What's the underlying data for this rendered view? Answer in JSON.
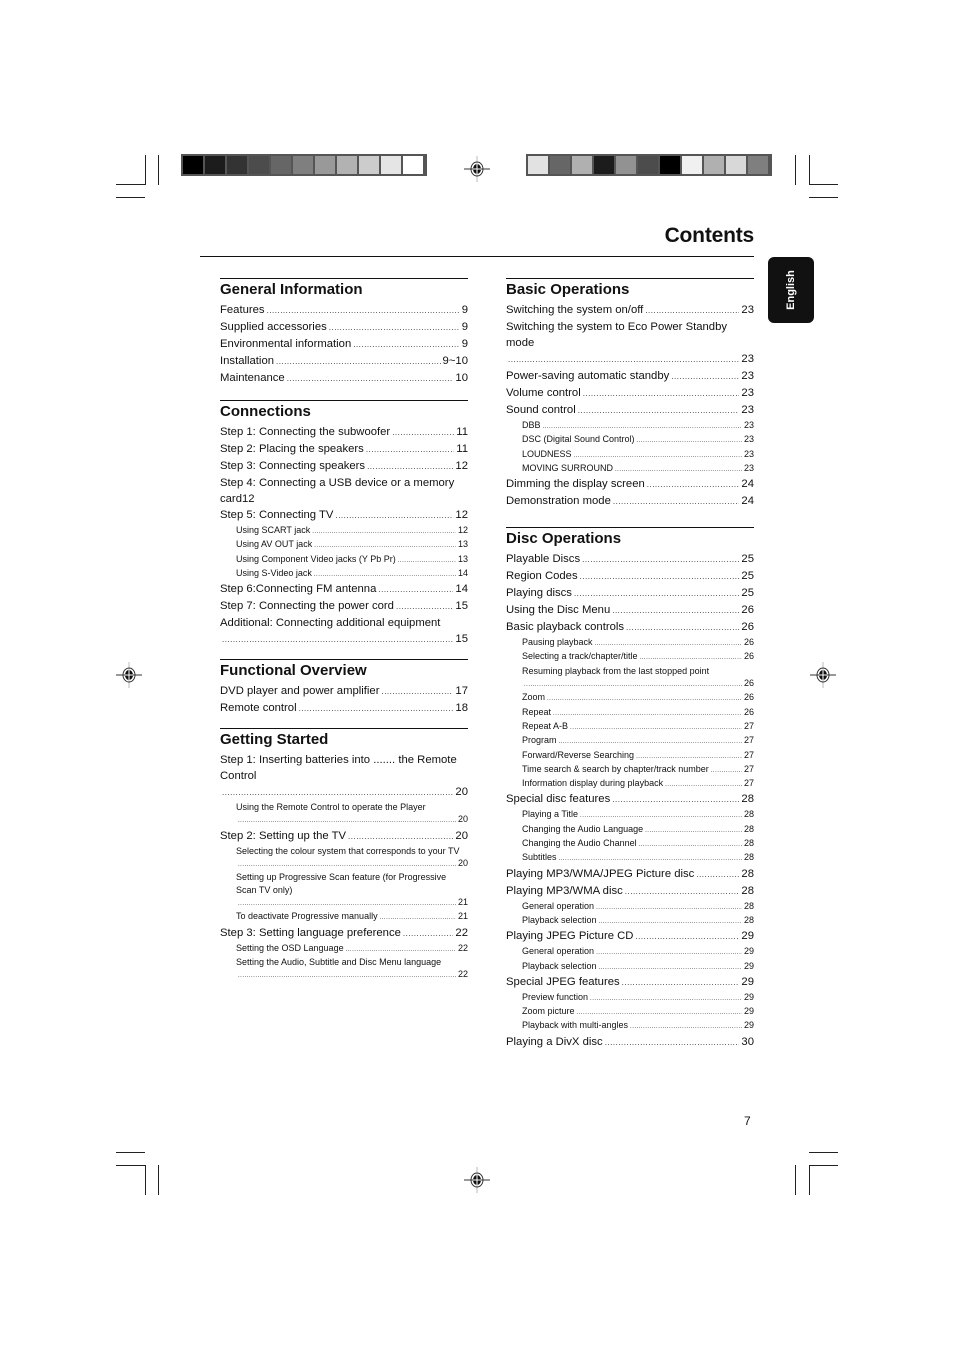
{
  "header": {
    "title": "Contents",
    "language_tab": "English",
    "left_swatches": [
      "#000000",
      "#1c1c1c",
      "#333333",
      "#4c4c4c",
      "#666666",
      "#7f7f7f",
      "#999999",
      "#b2b2b2",
      "#cccccc",
      "#e5e5e5",
      "#ffffff"
    ],
    "right_swatches": [
      "#e2e2e2",
      "#666666",
      "#b0b0b0",
      "#1c1c1c",
      "#929292",
      "#4c4c4c",
      "#000000",
      "#f0f0f0",
      "#b0b0b0",
      "#d8d8d8",
      "#7f7f7f"
    ]
  },
  "left_column": {
    "general_information": {
      "heading": "General Information",
      "entries": [
        {
          "label": "Features",
          "page": "9"
        },
        {
          "label": "Supplied accessories",
          "page": "9"
        },
        {
          "label": "Environmental information",
          "page": "9"
        },
        {
          "label": "Installation",
          "page": "9~10"
        },
        {
          "label": "Maintenance",
          "page": "10"
        }
      ]
    },
    "connections": {
      "heading": "Connections",
      "entries": [
        {
          "label": "Step 1: Connecting the subwoofer",
          "page": "11"
        },
        {
          "label": "Step 2: Placing the speakers",
          "page": "11"
        },
        {
          "label": "Step 3: Connecting speakers",
          "page": "12"
        },
        {
          "label": "Step 4: Connecting a USB device or a memory card12",
          "page": ""
        },
        {
          "label": "Step 5: Connecting TV",
          "page": "12"
        },
        {
          "label": "Using SCART jack",
          "page": "12",
          "sub": true
        },
        {
          "label": "Using AV OUT jack",
          "page": "13",
          "sub": true
        },
        {
          "label": "Using Component Video jacks (Y Pb Pr)",
          "page": "13",
          "sub": true
        },
        {
          "label": "Using S-Video jack",
          "page": "14",
          "sub": true
        },
        {
          "label": "Step 6:Connecting FM  antenna",
          "page": "14"
        },
        {
          "label": "Step 7: Connecting the power cord",
          "page": "15"
        },
        {
          "label": "Additional: Connecting additional equipment",
          "page": "15"
        }
      ]
    },
    "functional_overview": {
      "heading": "Functional Overview",
      "entries": [
        {
          "label": "DVD player and power amplifier",
          "page": "17"
        },
        {
          "label": "Remote control",
          "page": "18"
        }
      ]
    },
    "getting_started": {
      "heading": "Getting Started",
      "entries": [
        {
          "label": "Step 1: Inserting batteries into ....... the Remote Control",
          "page": "20"
        },
        {
          "label": "Using the Remote Control to operate the Player",
          "page": "20",
          "sub": true
        },
        {
          "label": "Step 2: Setting up the TV",
          "page": "20"
        },
        {
          "label": "Selecting the colour system that corresponds to your TV",
          "page": "20",
          "sub": true
        },
        {
          "label": "Setting up Progressive Scan feature (for Progressive Scan TV only)",
          "page": "21",
          "sub": true
        },
        {
          "label": "To deactivate Progressive manually",
          "page": "21",
          "sub": true
        },
        {
          "label": "Step 3: Setting language preference",
          "page": "22"
        },
        {
          "label": "Setting the OSD Language",
          "page": "22",
          "sub": true
        },
        {
          "label": "Setting the Audio, Subtitle and Disc Menu language",
          "page": "22",
          "sub": true
        }
      ]
    }
  },
  "right_column": {
    "basic_operations": {
      "heading": "Basic Operations",
      "entries": [
        {
          "label": "Switching the system on/off",
          "page": "23"
        },
        {
          "label": "Switching the system to Eco Power Standby mode",
          "page": "23"
        },
        {
          "label": "Power-saving automatic standby",
          "page": "23"
        },
        {
          "label": "Volume control",
          "page": "23"
        },
        {
          "label": "Sound control",
          "page": "23"
        },
        {
          "label": "DBB",
          "page": "23",
          "sub": true
        },
        {
          "label": "DSC (Digital Sound Control)",
          "page": "23",
          "sub": true
        },
        {
          "label": "LOUDNESS",
          "page": "23",
          "sub": true
        },
        {
          "label": "MOVING SURROUND",
          "page": "23",
          "sub": true
        },
        {
          "label": "Dimming the display screen",
          "page": "24"
        },
        {
          "label": "Demonstration mode",
          "page": "24"
        }
      ]
    },
    "disc_operations": {
      "heading": "Disc Operations",
      "entries": [
        {
          "label": "Playable Discs",
          "page": "25"
        },
        {
          "label": "Region Codes",
          "page": "25"
        },
        {
          "label": "Playing discs",
          "page": "25"
        },
        {
          "label": "Using the Disc Menu",
          "page": "26"
        },
        {
          "label": "Basic playback controls",
          "page": "26"
        },
        {
          "label": "Pausing playback",
          "page": "26",
          "sub": true
        },
        {
          "label": "Selecting a track/chapter/title",
          "page": "26",
          "sub": true
        },
        {
          "label": "Resuming playback from the last stopped point",
          "page": "26",
          "sub": true
        },
        {
          "label": "Zoom",
          "page": "26",
          "sub": true
        },
        {
          "label": "Repeat",
          "page": "26",
          "sub": true
        },
        {
          "label": "Repeat A-B",
          "page": "27",
          "sub": true
        },
        {
          "label": "Program",
          "page": "27",
          "sub": true
        },
        {
          "label": "Forward/Reverse Searching",
          "page": "27",
          "sub": true
        },
        {
          "label": "Time search & search by chapter/track number",
          "page": "27",
          "sub": true
        },
        {
          "label": "Information display during playback",
          "page": "27",
          "sub": true
        },
        {
          "label": "Special disc features",
          "page": "28"
        },
        {
          "label": "Playing a Title",
          "page": "28",
          "sub": true
        },
        {
          "label": "Changing the Audio Language",
          "page": "28",
          "sub": true
        },
        {
          "label": "Changing the Audio Channel",
          "page": "28",
          "sub": true
        },
        {
          "label": "Subtitles",
          "page": "28",
          "sub": true
        },
        {
          "label": "Playing MP3/WMA/JPEG Picture disc",
          "page": "28"
        },
        {
          "label": "Playing MP3/WMA disc",
          "page": "28"
        },
        {
          "label": "General operation",
          "page": "28",
          "sub": true
        },
        {
          "label": "Playback selection",
          "page": "28",
          "sub": true
        },
        {
          "label": "Playing JPEG Picture CD",
          "page": "29"
        },
        {
          "label": "General operation",
          "page": "29",
          "sub": true
        },
        {
          "label": "Playback selection",
          "page": "29",
          "sub": true
        },
        {
          "label": "Special JPEG features",
          "page": "29"
        },
        {
          "label": "Preview function",
          "page": "29",
          "sub": true
        },
        {
          "label": "Zoom picture",
          "page": "29",
          "sub": true
        },
        {
          "label": "Playback with multi-angles",
          "page": "29",
          "sub": true
        },
        {
          "label": "Playing a DivX disc",
          "page": "30"
        }
      ]
    }
  },
  "footer": {
    "page_number": "7"
  }
}
